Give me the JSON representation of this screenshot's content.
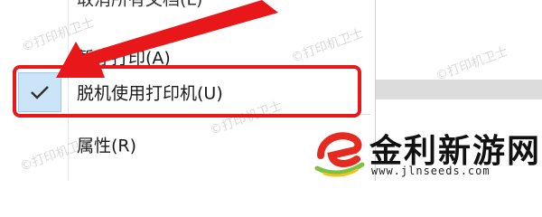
{
  "menu": {
    "items": [
      {
        "label": "取消所有文档(L)"
      },
      {
        "label": "暂停打印(A)"
      },
      {
        "label": "脱机使用打印机(U)",
        "checked": true
      },
      {
        "label": "属性(R)"
      }
    ]
  },
  "watermark": {
    "text": "©打印机卫士"
  },
  "logo": {
    "title": "金利新游网",
    "url": "www.jlnseeds.com"
  },
  "colors": {
    "highlight": "#e8181a",
    "check_background": "#cce4f7",
    "logo_red": "#e52a1f",
    "logo_green": "#7cc142"
  },
  "icons": [
    "checkmark-icon",
    "pointer-arrow",
    "logo-e-icon"
  ]
}
